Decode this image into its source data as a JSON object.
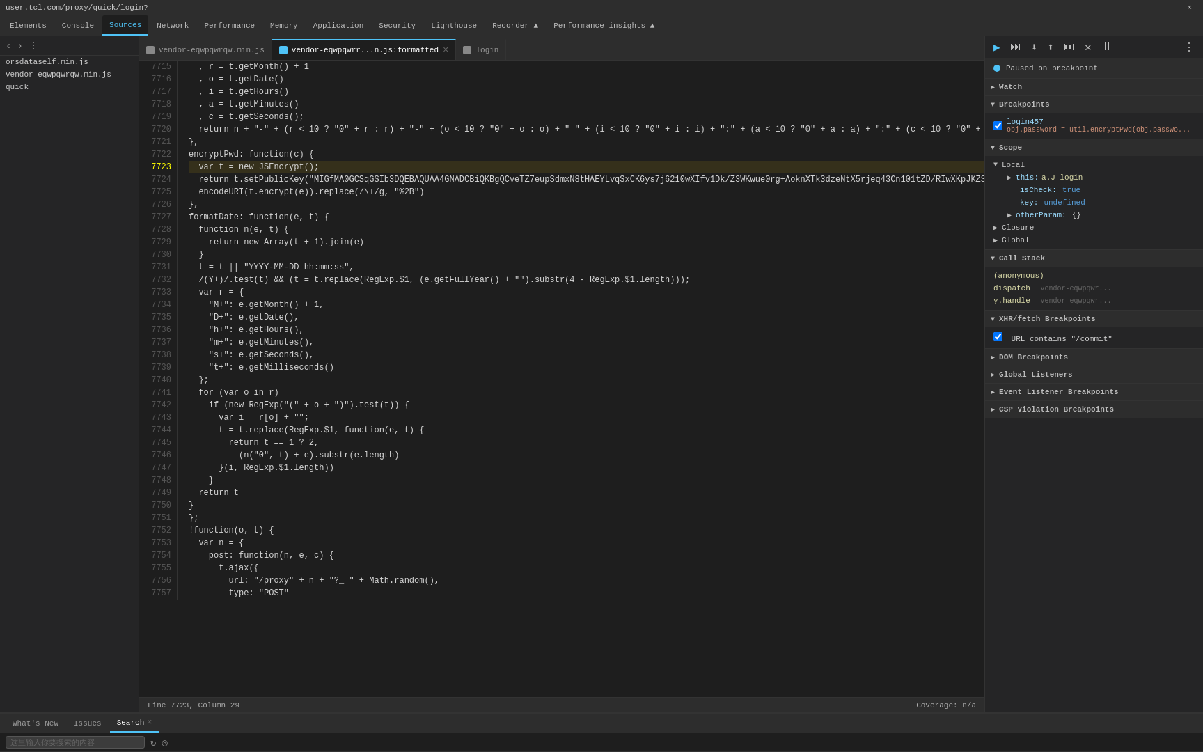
{
  "titleBar": {
    "url": "user.tcl.com/proxy/quick/login?",
    "closeButton": "×"
  },
  "navTabs": [
    {
      "label": "Elements",
      "active": false,
      "id": "elements"
    },
    {
      "label": "Console",
      "active": false,
      "id": "console"
    },
    {
      "label": "Sources",
      "active": true,
      "id": "sources"
    },
    {
      "label": "Network",
      "active": false,
      "id": "network"
    },
    {
      "label": "Performance",
      "active": false,
      "id": "performance"
    },
    {
      "label": "Memory",
      "active": false,
      "id": "memory"
    },
    {
      "label": "Application",
      "active": false,
      "id": "application"
    },
    {
      "label": "Security",
      "active": false,
      "id": "security"
    },
    {
      "label": "Lighthouse",
      "active": false,
      "id": "lighthouse"
    },
    {
      "label": "Recorder ▲",
      "active": false,
      "id": "recorder"
    },
    {
      "label": "Performance insights ▲",
      "active": false,
      "id": "perf-insights"
    }
  ],
  "sidebar": {
    "files": [
      {
        "label": "orsdataself.min.js",
        "active": false
      },
      {
        "label": "vendor-eqwpqwrqw.min.js",
        "active": false
      },
      {
        "label": "quick",
        "active": false
      }
    ]
  },
  "fileTabs": [
    {
      "label": "vendor-eqwpqwrqw.min.js",
      "active": false,
      "closeable": false
    },
    {
      "label": "vendor-eqwpqwrr...n.js:formatted",
      "active": true,
      "closeable": true
    },
    {
      "label": "login",
      "active": false,
      "closeable": false
    }
  ],
  "codeLines": [
    {
      "num": 7715,
      "code": "  , r = t.getMonth() + 1"
    },
    {
      "num": 7716,
      "code": "  , o = t.getDate()"
    },
    {
      "num": 7717,
      "code": "  , i = t.getHours()"
    },
    {
      "num": 7718,
      "code": "  , a = t.getMinutes()"
    },
    {
      "num": 7719,
      "code": "  , c = t.getSeconds();"
    },
    {
      "num": 7720,
      "code": "  return n + \"-\" + (r < 10 ? \"0\" + r : r) + \"-\" + (o < 10 ? \"0\" + o : o) + \" \" + (i < 10 ? \"0\" + i : i) + \":\" + (a < 10 ? \"0\" + a : a) + \":\" + (c < 10 ? \"0\" + c : c)"
    },
    {
      "num": 7721,
      "code": "},"
    },
    {
      "num": 7722,
      "code": "encryptPwd: function(c) {"
    },
    {
      "num": 7723,
      "code": "  var t = new JSEncrypt();",
      "highlighted": true
    },
    {
      "num": 7724,
      "code": "  return t.setPublicKey(\"MIGfMA0GCSqGSIb3DQEBAQUAA4GNADCBiQKBgQCveTZ7eupSdmxN8tHAEYLvqSxCK6ys7j6210wXIfv1Dk/Z3WKwue0rg+AoknXTk3dzeNtX5rjeq43Cn101tZD/RIwXKpJKZSGRh3Nm7Xc0ahd103gQ..."
    },
    {
      "num": 7725,
      "code": "  encodeURI(t.encrypt(e)).replace(/\\+/g, \"%2B\")"
    },
    {
      "num": 7726,
      "code": "},"
    },
    {
      "num": 7727,
      "code": "formatDate: function(e, t) {"
    },
    {
      "num": 7728,
      "code": "  function n(e, t) {"
    },
    {
      "num": 7729,
      "code": "    return new Array(t + 1).join(e)"
    },
    {
      "num": 7730,
      "code": "  }"
    },
    {
      "num": 7731,
      "code": "  t = t || \"YYYY-MM-DD hh:mm:ss\","
    },
    {
      "num": 7732,
      "code": "  /(Y+)/.test(t) && (t = t.replace(RegExp.$1, (e.getFullYear() + \"\").substr(4 - RegExp.$1.length)));"
    },
    {
      "num": 7733,
      "code": "  var r = {"
    },
    {
      "num": 7734,
      "code": "    \"M+\": e.getMonth() + 1,"
    },
    {
      "num": 7735,
      "code": "    \"D+\": e.getDate(),"
    },
    {
      "num": 7736,
      "code": "    \"h+\": e.getHours(),"
    },
    {
      "num": 7737,
      "code": "    \"m+\": e.getMinutes(),"
    },
    {
      "num": 7738,
      "code": "    \"s+\": e.getSeconds(),"
    },
    {
      "num": 7739,
      "code": "    \"t+\": e.getMilliseconds()"
    },
    {
      "num": 7740,
      "code": "  };"
    },
    {
      "num": 7741,
      "code": "  for (var o in r)"
    },
    {
      "num": 7742,
      "code": "    if (new RegExp(\"(\" + o + \")\").test(t)) {"
    },
    {
      "num": 7743,
      "code": "      var i = r[o] + \"\";"
    },
    {
      "num": 7744,
      "code": "      t = t.replace(RegExp.$1, function(e, t) {"
    },
    {
      "num": 7745,
      "code": "        return t == 1 ? 2,"
    },
    {
      "num": 7746,
      "code": "          (n(\"0\", t) + e).substr(e.length)"
    },
    {
      "num": 7747,
      "code": "      }(i, RegExp.$1.length))"
    },
    {
      "num": 7748,
      "code": "    }"
    },
    {
      "num": 7749,
      "code": "  return t"
    },
    {
      "num": 7750,
      "code": "}"
    },
    {
      "num": 7751,
      "code": "};"
    },
    {
      "num": 7752,
      "code": "!function(o, t) {"
    },
    {
      "num": 7753,
      "code": "  var n = {"
    },
    {
      "num": 7754,
      "code": "    post: function(n, e, c) {"
    },
    {
      "num": 7755,
      "code": "      t.ajax({"
    },
    {
      "num": 7756,
      "code": "        url: \"/proxy\" + n + \"?_=\" + Math.random(),"
    },
    {
      "num": 7757,
      "code": "        type: \"POST\""
    }
  ],
  "statusBar": {
    "line": "Line 7723, Column 29",
    "coverage": "Coverage: n/a"
  },
  "rightPanel": {
    "pausedMessage": "Paused on breakpoint",
    "sections": {
      "watch": {
        "label": "Watch",
        "expanded": false
      },
      "breakpoints": {
        "label": "Breakpoints",
        "expanded": true,
        "items": [
          {
            "id": "login457",
            "condition": "obj.password = util.encryptPwd(obj.passwo..."
          }
        ]
      },
      "scope": {
        "label": "Scope",
        "expanded": true,
        "local": {
          "label": "Local",
          "items": [
            {
              "key": "this: a.J-login",
              "value": ""
            },
            {
              "key": "isCheck:",
              "value": "true"
            },
            {
              "key": "key:",
              "value": "undefined"
            },
            {
              "key": "otherParam:",
              "value": "{}"
            }
          ]
        },
        "closure": {
          "label": "Closure"
        },
        "global": {
          "label": "Global"
        }
      },
      "callStack": {
        "label": "Call Stack",
        "expanded": true,
        "items": [
          {
            "name": "(anonymous)",
            "file": "",
            "active": true
          },
          {
            "name": "dispatch",
            "file": "vendor-eqwpqwr..."
          },
          {
            "name": "y.handle",
            "file": "vendor-eqwpqwr..."
          }
        ]
      },
      "xhrBreakpoints": {
        "label": "XHR/fetch Breakpoints",
        "expanded": true,
        "items": [
          {
            "label": "URL contains \"/commit\"",
            "checked": true
          }
        ]
      },
      "domBreakpoints": {
        "label": "DOM Breakpoints",
        "expanded": false
      },
      "globalListeners": {
        "label": "Global Listeners",
        "expanded": false
      },
      "eventListenerBreakpoints": {
        "label": "Event Listener Breakpoints",
        "expanded": false
      },
      "cspViolationBreakpoints": {
        "label": "CSP Violation Breakpoints",
        "expanded": false
      }
    }
  },
  "bottomPanel": {
    "tabs": [
      {
        "label": "What's New",
        "active": false
      },
      {
        "label": "Issues",
        "active": false
      },
      {
        "label": "Search",
        "active": true,
        "closeable": true
      }
    ],
    "searchPlaceholder": "这里输入你要搜索的内容"
  },
  "debugToolbar": {
    "buttons": [
      "▶",
      "⏭",
      "⬇",
      "⬆",
      "⬆",
      "➡",
      "⏪",
      "⏹"
    ]
  }
}
